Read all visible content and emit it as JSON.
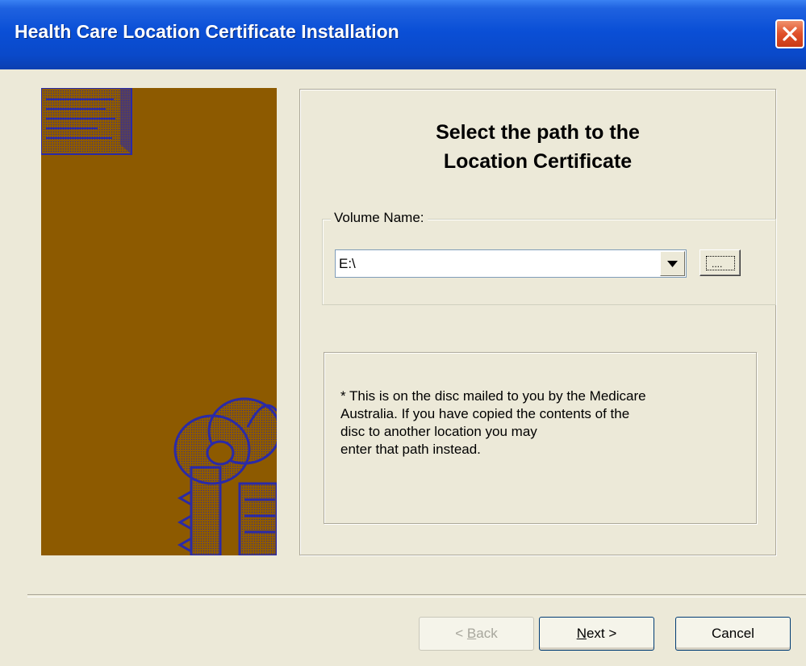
{
  "window": {
    "title": "Health Care Location Certificate Installation",
    "close_icon": "close-icon"
  },
  "main": {
    "heading_line1": "Select the path to the",
    "heading_line2": "Location Certificate",
    "volume_group_label": "Volume Name:",
    "volume_value": "E:\\",
    "browse_label": "....",
    "note_lines": [
      "* This is on the disc mailed to you by the Medicare",
      "  Australia.  If you have copied the contents of the",
      "  disc to another location you may",
      "  enter that path instead."
    ]
  },
  "buttons": {
    "back_prefix": "< ",
    "back_mnemonic": "B",
    "back_rest": "ack",
    "next_mnemonic": "N",
    "next_rest": "ext >",
    "cancel": "Cancel"
  },
  "colors": {
    "art_background": "#8d5a00",
    "art_line": "#2020a0"
  }
}
